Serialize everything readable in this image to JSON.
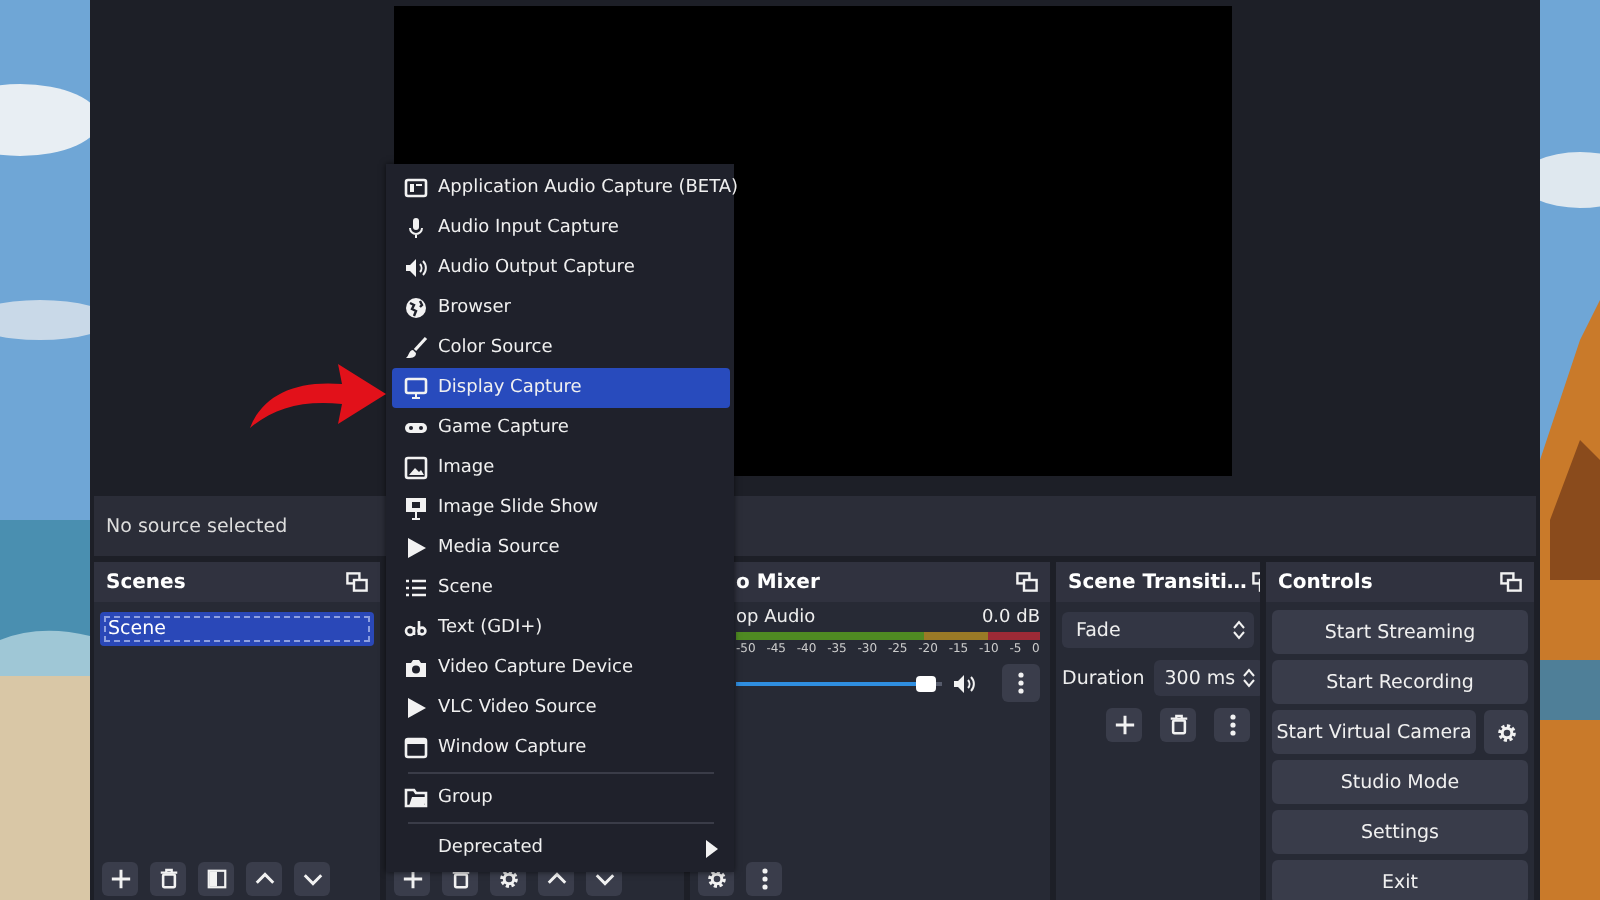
{
  "source_bar": {
    "text": "No source selected"
  },
  "scenes": {
    "title": "Scenes",
    "items": [
      {
        "label": "Scene",
        "selected": true
      }
    ]
  },
  "source_menu": {
    "sections": [
      [
        {
          "label": "Application Audio Capture (BETA)",
          "selected": false
        },
        {
          "label": "Audio Input Capture",
          "selected": false
        },
        {
          "label": "Audio Output Capture",
          "selected": false
        },
        {
          "label": "Browser",
          "selected": false
        },
        {
          "label": "Color Source",
          "selected": false
        },
        {
          "label": "Display Capture",
          "selected": true
        },
        {
          "label": "Game Capture",
          "selected": false
        },
        {
          "label": "Image",
          "selected": false
        },
        {
          "label": "Image Slide Show",
          "selected": false
        },
        {
          "label": "Media Source",
          "selected": false
        },
        {
          "label": "Scene",
          "selected": false
        },
        {
          "label": "Text (GDI+)",
          "selected": false
        },
        {
          "label": "Video Capture Device",
          "selected": false
        },
        {
          "label": "VLC Video Source",
          "selected": false
        },
        {
          "label": "Window Capture",
          "selected": false
        }
      ],
      [
        {
          "label": "Group",
          "selected": false
        }
      ],
      [
        {
          "label": "Deprecated",
          "selected": false,
          "has_submenu": true
        }
      ]
    ]
  },
  "audio_mixer": {
    "title": "o Mixer",
    "channels": [
      {
        "name": "op Audio",
        "reading": "0.0 dB",
        "level": 0.92,
        "scale": [
          "-50",
          "-45",
          "-40",
          "-35",
          "-30",
          "-25",
          "-20",
          "-15",
          "-10",
          "-5",
          "0"
        ]
      }
    ]
  },
  "scene_transitions": {
    "title": "Scene Transiti…",
    "transition": "Fade",
    "duration_label": "Duration",
    "duration": "300 ms"
  },
  "controls": {
    "title": "Controls",
    "buttons": [
      {
        "label": "Start Streaming",
        "kind": "plain"
      },
      {
        "label": "Start Recording",
        "kind": "plain"
      },
      {
        "label": "Start Virtual Camera",
        "kind": "with-settings"
      },
      {
        "label": "Studio Mode",
        "kind": "plain"
      },
      {
        "label": "Settings",
        "kind": "plain"
      },
      {
        "label": "Exit",
        "kind": "plain"
      }
    ]
  }
}
